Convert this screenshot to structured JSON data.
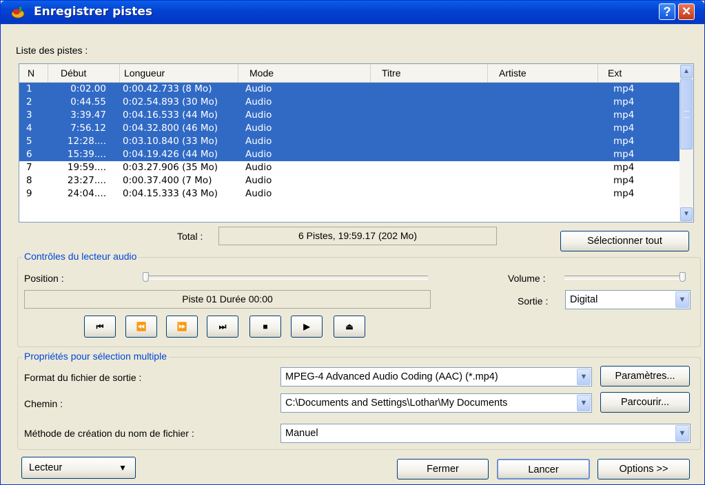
{
  "window": {
    "title": "Enregistrer pistes",
    "help_label": "?",
    "close_label": "✕"
  },
  "tracklist": {
    "label": "Liste des pistes :",
    "columns": [
      "N",
      "Début",
      "Longueur",
      "Mode",
      "Titre",
      "Artiste",
      "Ext"
    ],
    "rows": [
      {
        "n": "1",
        "start": "0:02.00",
        "length": "0:00.42.733 (8 Mo)",
        "mode": "Audio",
        "title": "",
        "artist": "",
        "ext": "mp4",
        "selected": true
      },
      {
        "n": "2",
        "start": "0:44.55",
        "length": "0:02.54.893 (30 Mo)",
        "mode": "Audio",
        "title": "",
        "artist": "",
        "ext": "mp4",
        "selected": true
      },
      {
        "n": "3",
        "start": "3:39.47",
        "length": "0:04.16.533 (44 Mo)",
        "mode": "Audio",
        "title": "",
        "artist": "",
        "ext": "mp4",
        "selected": true
      },
      {
        "n": "4",
        "start": "7:56.12",
        "length": "0:04.32.800 (46 Mo)",
        "mode": "Audio",
        "title": "",
        "artist": "",
        "ext": "mp4",
        "selected": true
      },
      {
        "n": "5",
        "start": "12:28....",
        "length": "0:03.10.840 (33 Mo)",
        "mode": "Audio",
        "title": "",
        "artist": "",
        "ext": "mp4",
        "selected": true
      },
      {
        "n": "6",
        "start": "15:39....",
        "length": "0:04.19.426 (44 Mo)",
        "mode": "Audio",
        "title": "",
        "artist": "",
        "ext": "mp4",
        "selected": true
      },
      {
        "n": "7",
        "start": "19:59....",
        "length": "0:03.27.906 (35 Mo)",
        "mode": "Audio",
        "title": "",
        "artist": "",
        "ext": "mp4",
        "selected": false
      },
      {
        "n": "8",
        "start": "23:27....",
        "length": "0:00.37.400 (7 Mo)",
        "mode": "Audio",
        "title": "",
        "artist": "",
        "ext": "mp4",
        "selected": false
      },
      {
        "n": "9",
        "start": "24:04....",
        "length": "0:04.15.333 (43 Mo)",
        "mode": "Audio",
        "title": "",
        "artist": "",
        "ext": "mp4",
        "selected": false
      }
    ],
    "total_label": "Total :",
    "total_value": "6 Pistes,   19:59.17 (202 Mo)",
    "select_all_label": "Sélectionner tout"
  },
  "player": {
    "group_label": "Contrôles du lecteur audio",
    "position_label": "Position :",
    "position_value": 0,
    "volume_label": "Volume :",
    "volume_value": 1,
    "status_text": "Piste 01 Durée 00:00",
    "output_label": "Sortie :",
    "output_value": "Digital",
    "buttons": [
      {
        "name": "previous-track",
        "glyph": "⏮"
      },
      {
        "name": "rewind",
        "glyph": "⏪"
      },
      {
        "name": "fast-forward",
        "glyph": "⏩"
      },
      {
        "name": "next-track",
        "glyph": "⏭"
      },
      {
        "name": "stop",
        "glyph": "■"
      },
      {
        "name": "play",
        "glyph": "▶"
      },
      {
        "name": "eject",
        "glyph": "⏏"
      }
    ]
  },
  "properties": {
    "group_label": "Propriétés pour sélection multiple",
    "format_label": "Format du fichier de sortie :",
    "format_value": "MPEG-4 Advanced Audio Coding (AAC) (*.mp4)",
    "params_label": "Paramètres...",
    "path_label": "Chemin :",
    "path_value": "C:\\Documents and Settings\\Lothar\\My Documents",
    "browse_label": "Parcourir...",
    "naming_label": "Méthode de création du nom de fichier :",
    "naming_value": "Manuel"
  },
  "footer": {
    "player_menu_label": "Lecteur",
    "close_label": "Fermer",
    "start_label": "Lancer",
    "options_label": "Options >>"
  },
  "colors": {
    "selection": "#316ac5",
    "titlebar": "#0443d4",
    "group_label": "#0046d5"
  }
}
